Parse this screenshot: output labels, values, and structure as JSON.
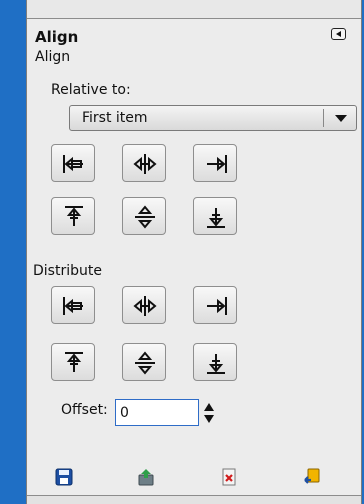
{
  "dialog": {
    "title": "Align",
    "subtitle": "Align"
  },
  "align": {
    "relative_label": "Relative to:",
    "relative_value": "First item",
    "buttons": [
      {
        "icon": "align-left-edge-icon"
      },
      {
        "icon": "align-center-horizontal-icon"
      },
      {
        "icon": "align-right-edge-icon"
      },
      {
        "icon": "align-top-edge-icon"
      },
      {
        "icon": "align-middle-vertical-icon"
      },
      {
        "icon": "align-bottom-edge-icon"
      }
    ]
  },
  "distribute": {
    "label": "Distribute",
    "offset_label": "Offset:",
    "offset_value": "0",
    "buttons": [
      {
        "icon": "distribute-left-edges-icon"
      },
      {
        "icon": "distribute-centers-horizontal-icon"
      },
      {
        "icon": "distribute-right-edges-icon"
      },
      {
        "icon": "distribute-top-edges-icon"
      },
      {
        "icon": "distribute-middles-vertical-icon"
      },
      {
        "icon": "distribute-bottom-edges-icon"
      }
    ]
  },
  "footer": {
    "icons": [
      "save-icon",
      "restore-icon",
      "delete-icon",
      "reset-icon"
    ]
  },
  "colors": {
    "background": "#1f6fc5",
    "panel": "#ececec",
    "accent": "#2e6cc7"
  }
}
